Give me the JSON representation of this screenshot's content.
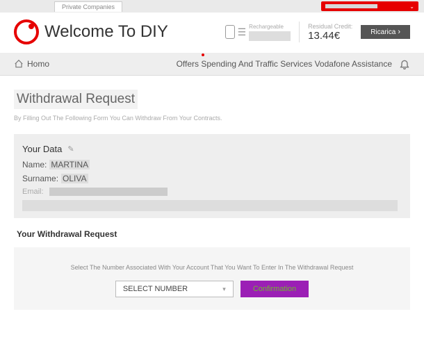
{
  "top": {
    "tab": "Private Companies"
  },
  "header": {
    "welcome_big": "Welcome To DIY",
    "phone_label": "Rechargeable",
    "credit_label": "Residual Credit:",
    "credit_value": "13.44€",
    "ricarica": "Ricarica"
  },
  "nav": {
    "home": "Homo",
    "links": "Offers Spending And Traffic Services Vodafone Assistance"
  },
  "page": {
    "title": "Withdrawal Request",
    "subtitle": "By Filling Out The Following Form You Can Withdraw From Your Contracts."
  },
  "data": {
    "section_title": "Your Data",
    "name_label": "Name:",
    "name_value": "MARTINA",
    "surname_label": "Surname:",
    "surname_value": "OLIVA",
    "email_label": "Email:"
  },
  "withdrawal": {
    "header": "Your Withdrawal Request",
    "instruction": "Select The Number Associated With Your Account That You Want To Enter In The Withdrawal Request",
    "select_placeholder": "SELECT NUMBER",
    "confirm": "Confirmation"
  }
}
